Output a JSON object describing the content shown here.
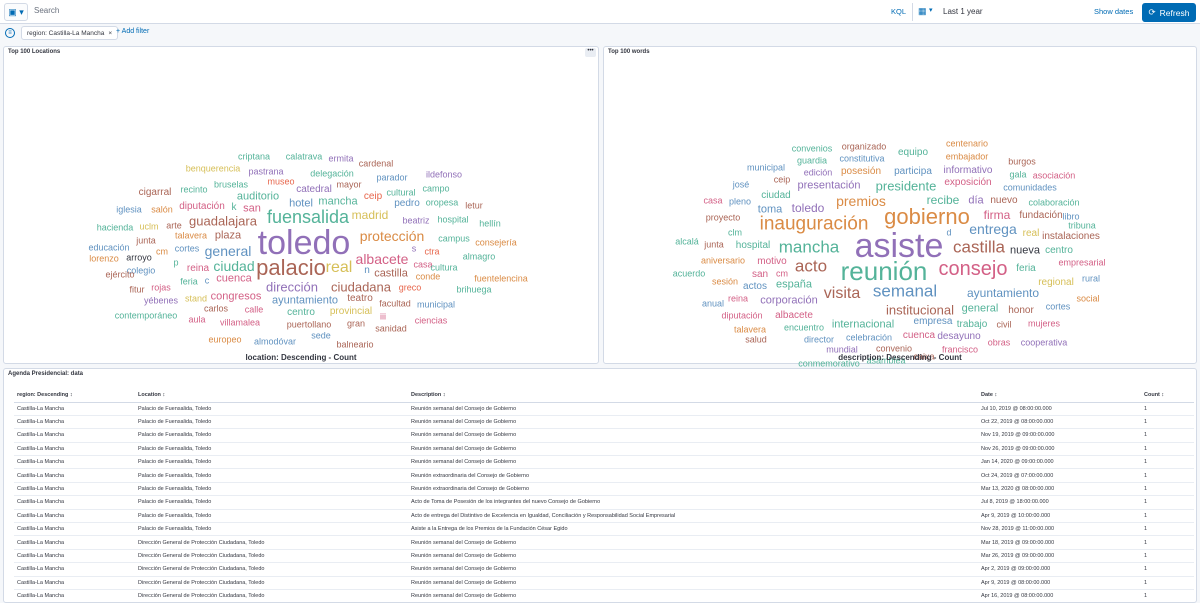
{
  "query": {
    "placeholder": "Search",
    "language": "KQL"
  },
  "time": {
    "range": "Last 1 year",
    "show_dates": "Show dates",
    "refresh": "Refresh"
  },
  "filters": {
    "pill": "region: Castilla-La Mancha",
    "remove": "×",
    "add": "+ Add filter"
  },
  "locations_panel": {
    "title": "Top 100 Locations",
    "menu": "•••",
    "caption": "location: Descending - Count"
  },
  "words_panel": {
    "title": "Top 100 words",
    "caption": "description: Descending - Count"
  },
  "locations_words": [
    [
      "criptana",
      250,
      110,
      9,
      "#54b399"
    ],
    [
      "calatrava",
      300,
      110,
      9,
      "#54b399"
    ],
    [
      "ermita",
      337,
      112,
      9,
      "#9170b8"
    ],
    [
      "cardenal",
      372,
      117,
      9,
      "#aa6556"
    ],
    [
      "benquerencia",
      209,
      122,
      9,
      "#d6bf57"
    ],
    [
      "pastrana",
      262,
      125,
      9,
      "#9170b8"
    ],
    [
      "delegación",
      328,
      127,
      9,
      "#54b399"
    ],
    [
      "ildefonso",
      440,
      128,
      9,
      "#9170b8"
    ],
    [
      "parador",
      388,
      131,
      9,
      "#6092c0"
    ],
    [
      "museo",
      277,
      135,
      9,
      "#e7664c"
    ],
    [
      "bruselas",
      227,
      138,
      9,
      "#54b399"
    ],
    [
      "mayor",
      345,
      138,
      9,
      "#aa6556"
    ],
    [
      "recinto",
      190,
      143,
      9,
      "#54b399"
    ],
    [
      "catedral",
      310,
      143,
      10,
      "#9170b8"
    ],
    [
      "campo",
      432,
      142,
      9,
      "#54b399"
    ],
    [
      "cigarral",
      151,
      146,
      10,
      "#aa6556"
    ],
    [
      "auditorio",
      254,
      150,
      11,
      "#54b399"
    ],
    [
      "cultural",
      397,
      146,
      9,
      "#54b399"
    ],
    [
      "ceip",
      369,
      150,
      10,
      "#e7664c"
    ],
    [
      "mancha",
      334,
      155,
      11,
      "#54b399"
    ],
    [
      "pedro",
      403,
      157,
      10,
      "#6092c0"
    ],
    [
      "oropesa",
      438,
      156,
      9,
      "#54b399"
    ],
    [
      "letur",
      470,
      159,
      9,
      "#aa6556"
    ],
    [
      "iglesia",
      125,
      163,
      9,
      "#6092c0"
    ],
    [
      "salón",
      158,
      163,
      9,
      "#da8b45"
    ],
    [
      "diputación",
      198,
      160,
      10,
      "#d36086"
    ],
    [
      "k",
      230,
      161,
      10,
      "#54b399"
    ],
    [
      "san",
      248,
      162,
      11,
      "#d36086"
    ],
    [
      "hotel",
      297,
      157,
      11,
      "#6092c0"
    ],
    [
      "madrid",
      366,
      168,
      12,
      "#d6bf57"
    ],
    [
      "fuensalida",
      304,
      170,
      18,
      "#54b399"
    ],
    [
      "guadalajara",
      219,
      174,
      13,
      "#aa6556"
    ],
    [
      "beatriz",
      412,
      174,
      9,
      "#9170b8"
    ],
    [
      "hospital",
      449,
      173,
      9,
      "#54b399"
    ],
    [
      "hellín",
      486,
      177,
      9,
      "#54b399"
    ],
    [
      "hacienda",
      111,
      181,
      9,
      "#54b399"
    ],
    [
      "uclm",
      145,
      180,
      9,
      "#d6bf57"
    ],
    [
      "arte",
      170,
      179,
      9,
      "#aa6556"
    ],
    [
      "junta",
      142,
      194,
      9,
      "#aa6556"
    ],
    [
      "talavera",
      187,
      189,
      9,
      "#da8b45"
    ],
    [
      "plaza",
      224,
      189,
      11,
      "#aa6556"
    ],
    [
      "toledo",
      300,
      196,
      34,
      "#9170b8"
    ],
    [
      "protección",
      388,
      189,
      14,
      "#da8b45"
    ],
    [
      "campus",
      450,
      192,
      9,
      "#54b399"
    ],
    [
      "consejería",
      492,
      196,
      9,
      "#da8b45"
    ],
    [
      "educación",
      105,
      201,
      9,
      "#6092c0"
    ],
    [
      "cm",
      158,
      205,
      9,
      "#da8b45"
    ],
    [
      "cortes",
      183,
      202,
      9,
      "#6092c0"
    ],
    [
      "general",
      224,
      204,
      14,
      "#6092c0"
    ],
    [
      "s",
      410,
      202,
      9,
      "#9170b8"
    ],
    [
      "ctra",
      428,
      205,
      9,
      "#e7664c"
    ],
    [
      "lorenzo",
      100,
      212,
      9,
      "#da8b45"
    ],
    [
      "arroyo",
      135,
      211,
      9,
      "#343741"
    ],
    [
      "p",
      172,
      216,
      9,
      "#54b399"
    ],
    [
      "almagro",
      475,
      210,
      9,
      "#54b399"
    ],
    [
      "albacete",
      378,
      212,
      14,
      "#d36086"
    ],
    [
      "palacio",
      287,
      221,
      22,
      "#aa6556"
    ],
    [
      "real",
      335,
      221,
      16,
      "#d6bf57"
    ],
    [
      "ciudad",
      230,
      219,
      14,
      "#54b399"
    ],
    [
      "reina",
      194,
      222,
      10,
      "#d36086"
    ],
    [
      "casa",
      419,
      218,
      9,
      "#d36086"
    ],
    [
      "colegio",
      137,
      224,
      9,
      "#6092c0"
    ],
    [
      "n",
      363,
      224,
      10,
      "#6092c0"
    ],
    [
      "castilla",
      387,
      227,
      11,
      "#aa6556"
    ],
    [
      "cultura",
      440,
      221,
      9,
      "#54b399"
    ],
    [
      "ejército",
      116,
      228,
      9,
      "#aa6556"
    ],
    [
      "conde",
      424,
      230,
      9,
      "#da8b45"
    ],
    [
      "feria",
      185,
      235,
      9,
      "#54b399"
    ],
    [
      "c",
      203,
      234,
      9,
      "#6092c0"
    ],
    [
      "cuenca",
      230,
      232,
      11,
      "#d36086"
    ],
    [
      "fuentelencina",
      497,
      232,
      9,
      "#da8b45"
    ],
    [
      "dirección",
      288,
      240,
      13,
      "#9170b8"
    ],
    [
      "ciudadana",
      357,
      240,
      13,
      "#aa6556"
    ],
    [
      "rojas",
      157,
      241,
      9,
      "#d36086"
    ],
    [
      "fitur",
      133,
      243,
      9,
      "#aa6556"
    ],
    [
      "greco",
      406,
      241,
      9,
      "#e7664c"
    ],
    [
      "brihuega",
      470,
      243,
      9,
      "#54b399"
    ],
    [
      "congresos",
      232,
      250,
      11,
      "#d36086"
    ],
    [
      "stand",
      192,
      252,
      9,
      "#d6bf57"
    ],
    [
      "ayuntamiento",
      301,
      254,
      11,
      "#6092c0"
    ],
    [
      "teatro",
      356,
      252,
      10,
      "#aa6556"
    ],
    [
      "yébenes",
      157,
      254,
      9,
      "#9170b8"
    ],
    [
      "facultad",
      391,
      257,
      9,
      "#aa6556"
    ],
    [
      "municipal",
      432,
      258,
      9,
      "#6092c0"
    ],
    [
      "carlos",
      212,
      262,
      9,
      "#aa6556"
    ],
    [
      "calle",
      250,
      263,
      9,
      "#d36086"
    ],
    [
      "centro",
      297,
      266,
      10,
      "#54b399"
    ],
    [
      "provincial",
      347,
      265,
      10,
      "#d6bf57"
    ],
    [
      "contemporáneo",
      142,
      269,
      9,
      "#54b399"
    ],
    [
      "iii",
      379,
      270,
      9,
      "#d36086"
    ],
    [
      "aula",
      193,
      273,
      9,
      "#d36086"
    ],
    [
      "villamalea",
      236,
      276,
      9,
      "#d36086"
    ],
    [
      "gran",
      352,
      277,
      9,
      "#aa6556"
    ],
    [
      "ciencias",
      427,
      274,
      9,
      "#d36086"
    ],
    [
      "puertollano",
      305,
      278,
      9,
      "#aa6556"
    ],
    [
      "sanidad",
      387,
      282,
      9,
      "#aa6556"
    ],
    [
      "sede",
      317,
      289,
      9,
      "#6092c0"
    ],
    [
      "europeo",
      221,
      293,
      9,
      "#da8b45"
    ],
    [
      "almodóvar",
      271,
      295,
      9,
      "#6092c0"
    ],
    [
      "balneario",
      351,
      298,
      9,
      "#aa6556"
    ]
  ],
  "description_words": [
    [
      "centenario",
      363,
      97,
      9,
      "#da8b45"
    ],
    [
      "convenios",
      208,
      102,
      9,
      "#54b399"
    ],
    [
      "organizado",
      260,
      100,
      9,
      "#aa6556"
    ],
    [
      "equipo",
      309,
      106,
      10,
      "#54b399"
    ],
    [
      "embajador",
      363,
      110,
      9,
      "#da8b45"
    ],
    [
      "guardia",
      208,
      114,
      9,
      "#54b399"
    ],
    [
      "constitutiva",
      258,
      112,
      9,
      "#6092c0"
    ],
    [
      "burgos",
      418,
      115,
      9,
      "#aa6556"
    ],
    [
      "municipal",
      162,
      121,
      9,
      "#6092c0"
    ],
    [
      "edición",
      214,
      126,
      9,
      "#9170b8"
    ],
    [
      "posesión",
      257,
      125,
      10,
      "#da8b45"
    ],
    [
      "participa",
      309,
      125,
      10,
      "#6092c0"
    ],
    [
      "informativo",
      364,
      124,
      10,
      "#9170b8"
    ],
    [
      "gala",
      414,
      128,
      9,
      "#54b399"
    ],
    [
      "asociación",
      450,
      129,
      9,
      "#d36086"
    ],
    [
      "ceip",
      178,
      133,
      9,
      "#aa6556"
    ],
    [
      "presentación",
      225,
      139,
      11,
      "#9170b8"
    ],
    [
      "presidente",
      302,
      139,
      13,
      "#54b399"
    ],
    [
      "exposición",
      364,
      136,
      10,
      "#d36086"
    ],
    [
      "comunidades",
      426,
      141,
      9,
      "#6092c0"
    ],
    [
      "josé",
      137,
      138,
      9,
      "#6092c0"
    ],
    [
      "ciudad",
      172,
      149,
      10,
      "#54b399"
    ],
    [
      "premios",
      257,
      154,
      14,
      "#da8b45"
    ],
    [
      "recibe",
      339,
      153,
      12,
      "#54b399"
    ],
    [
      "día",
      372,
      154,
      11,
      "#9170b8"
    ],
    [
      "nuevo",
      400,
      154,
      10,
      "#aa6556"
    ],
    [
      "colaboración",
      450,
      156,
      9,
      "#54b399"
    ],
    [
      "casa",
      109,
      154,
      9,
      "#d36086"
    ],
    [
      "pleno",
      136,
      155,
      9,
      "#6092c0"
    ],
    [
      "toma",
      166,
      163,
      11,
      "#6092c0"
    ],
    [
      "toledo",
      204,
      161,
      12,
      "#9170b8"
    ],
    [
      "gobierno",
      323,
      170,
      22,
      "#da8b45"
    ],
    [
      "firma",
      393,
      168,
      12,
      "#d36086"
    ],
    [
      "fundación",
      437,
      169,
      10,
      "#aa6556"
    ],
    [
      "libro",
      467,
      170,
      9,
      "#6092c0"
    ],
    [
      "proyecto",
      119,
      171,
      9,
      "#aa6556"
    ],
    [
      "inauguración",
      210,
      177,
      19,
      "#da8b45"
    ],
    [
      "entrega",
      389,
      182,
      14,
      "#6092c0"
    ],
    [
      "tribuna",
      478,
      179,
      9,
      "#54b399"
    ],
    [
      "clm",
      131,
      186,
      9,
      "#54b399"
    ],
    [
      "d",
      345,
      186,
      9,
      "#6092c0"
    ],
    [
      "asiste",
      295,
      199,
      34,
      "#9170b8"
    ],
    [
      "real",
      427,
      187,
      10,
      "#d6bf57"
    ],
    [
      "instalaciones",
      467,
      190,
      10,
      "#aa6556"
    ],
    [
      "alcalá",
      83,
      195,
      9,
      "#54b399"
    ],
    [
      "junta",
      110,
      198,
      9,
      "#aa6556"
    ],
    [
      "hospital",
      149,
      199,
      10,
      "#54b399"
    ],
    [
      "mancha",
      205,
      200,
      17,
      "#54b399"
    ],
    [
      "castilla",
      375,
      200,
      17,
      "#aa6556"
    ],
    [
      "nueva",
      421,
      204,
      11,
      "#343741"
    ],
    [
      "centro",
      455,
      204,
      10,
      "#54b399"
    ],
    [
      "aniversario",
      119,
      214,
      9,
      "#da8b45"
    ],
    [
      "motivo",
      168,
      215,
      10,
      "#d36086"
    ],
    [
      "acto",
      207,
      219,
      17,
      "#aa6556"
    ],
    [
      "reunión",
      280,
      224,
      26,
      "#54b399"
    ],
    [
      "consejo",
      369,
      222,
      20,
      "#d36086"
    ],
    [
      "feria",
      422,
      222,
      10,
      "#54b399"
    ],
    [
      "empresarial",
      478,
      216,
      9,
      "#d36086"
    ],
    [
      "acuerdo",
      85,
      227,
      9,
      "#54b399"
    ],
    [
      "san",
      156,
      228,
      10,
      "#d36086"
    ],
    [
      "cm",
      178,
      227,
      9,
      "#d36086"
    ],
    [
      "sesión",
      121,
      235,
      9,
      "#da8b45"
    ],
    [
      "actos",
      151,
      240,
      10,
      "#6092c0"
    ],
    [
      "españa",
      190,
      238,
      11,
      "#54b399"
    ],
    [
      "visita",
      238,
      247,
      16,
      "#aa6556"
    ],
    [
      "semanal",
      301,
      244,
      17,
      "#6092c0"
    ],
    [
      "ayuntamiento",
      399,
      246,
      12,
      "#6092c0"
    ],
    [
      "regional",
      452,
      236,
      10,
      "#d6bf57"
    ],
    [
      "rural",
      487,
      232,
      9,
      "#6092c0"
    ],
    [
      "reina",
      134,
      252,
      9,
      "#d36086"
    ],
    [
      "corporación",
      185,
      254,
      11,
      "#9170b8"
    ],
    [
      "social",
      484,
      252,
      9,
      "#da8b45"
    ],
    [
      "anual",
      109,
      257,
      9,
      "#6092c0"
    ],
    [
      "institucional",
      316,
      263,
      13,
      "#aa6556"
    ],
    [
      "general",
      376,
      262,
      11,
      "#54b399"
    ],
    [
      "honor",
      417,
      264,
      10,
      "#aa6556"
    ],
    [
      "cortes",
      454,
      260,
      9,
      "#6092c0"
    ],
    [
      "diputación",
      138,
      269,
      9,
      "#d36086"
    ],
    [
      "albacete",
      190,
      269,
      10,
      "#d36086"
    ],
    [
      "internacional",
      259,
      278,
      11,
      "#54b399"
    ],
    [
      "empresa",
      329,
      275,
      10,
      "#6092c0"
    ],
    [
      "trabajo",
      368,
      278,
      10,
      "#54b399"
    ],
    [
      "civil",
      400,
      278,
      9,
      "#aa6556"
    ],
    [
      "mujeres",
      440,
      277,
      9,
      "#d36086"
    ],
    [
      "talavera",
      146,
      283,
      9,
      "#da8b45"
    ],
    [
      "encuentro",
      200,
      281,
      9,
      "#54b399"
    ],
    [
      "salud",
      152,
      293,
      9,
      "#aa6556"
    ],
    [
      "director",
      215,
      293,
      9,
      "#6092c0"
    ],
    [
      "celebración",
      265,
      291,
      9,
      "#6092c0"
    ],
    [
      "cuenca",
      315,
      289,
      10,
      "#d36086"
    ],
    [
      "desayuno",
      355,
      290,
      10,
      "#9170b8"
    ],
    [
      "obras",
      395,
      296,
      9,
      "#d36086"
    ],
    [
      "cooperativa",
      440,
      296,
      9,
      "#9170b8"
    ],
    [
      "mundial",
      238,
      303,
      9,
      "#9170b8"
    ],
    [
      "convenio",
      290,
      302,
      9,
      "#aa6556"
    ],
    [
      "francisco",
      356,
      303,
      9,
      "#d36086"
    ],
    [
      "caixa",
      320,
      310,
      9,
      "#aa6556"
    ],
    [
      "conmemorativo",
      225,
      317,
      9,
      "#54b399"
    ],
    [
      "asamblea",
      282,
      314,
      9,
      "#54b399"
    ]
  ],
  "table": {
    "title": "Agenda Presidencial: data",
    "headers": [
      "region: Descending ↕",
      "Location ↕",
      "Description ↕",
      "Date ↕",
      "Count ↕"
    ],
    "rows": [
      [
        "Castilla-La Mancha",
        "Palacio de Fuensalida, Toledo",
        "Reunión semanal del Consejo de Gobierno",
        "Jul 10, 2019 @ 08:00:00.000",
        "1"
      ],
      [
        "Castilla-La Mancha",
        "Palacio de Fuensalida, Toledo",
        "Reunión semanal del Consejo de Gobierno",
        "Oct 22, 2019 @ 08:00:00.000",
        "1"
      ],
      [
        "Castilla-La Mancha",
        "Palacio de Fuensalida, Toledo",
        "Reunión semanal del Consejo de Gobierno",
        "Nov 19, 2019 @ 09:00:00.000",
        "1"
      ],
      [
        "Castilla-La Mancha",
        "Palacio de Fuensalida, Toledo",
        "Reunión semanal del Consejo de Gobierno",
        "Nov 26, 2019 @ 09:00:00.000",
        "1"
      ],
      [
        "Castilla-La Mancha",
        "Palacio de Fuensalida, Toledo",
        "Reunión semanal del Consejo de Gobierno",
        "Jan 14, 2020 @ 09:00:00.000",
        "1"
      ],
      [
        "Castilla-La Mancha",
        "Palacio de Fuensalida, Toledo",
        "Reunión extraordinaria del Consejo de Gobierno",
        "Oct 24, 2019 @ 07:00:00.000",
        "1"
      ],
      [
        "Castilla-La Mancha",
        "Palacio de Fuensalida, Toledo",
        "Reunión extraordinaria del Consejo de Gobierno",
        "Mar 13, 2020 @ 08:00:00.000",
        "1"
      ],
      [
        "Castilla-La Mancha",
        "Palacio de Fuensalida, Toledo",
        "Acto de Toma de Posesión de los integrantes del nuevo Consejo de Gobierno",
        "Jul 8, 2019 @ 18:00:00.000",
        "1"
      ],
      [
        "Castilla-La Mancha",
        "Palacio de Fuensalida, Toledo",
        "Acto de entrega del Distintivo de Excelencia en Igualdad, Conciliación y Responsabilidad Social Empresarial",
        "Apr 9, 2019 @ 10:00:00.000",
        "1"
      ],
      [
        "Castilla-La Mancha",
        "Palacio de Fuensalida, Toledo",
        "Asiste a la Entrega de los Premios de la Fundación César Egido",
        "Nov 28, 2019 @ 11:00:00.000",
        "1"
      ],
      [
        "Castilla-La Mancha",
        "Dirección General de Protección Ciudadana, Toledo",
        "Reunión semanal del Consejo de Gobierno",
        "Mar 18, 2019 @ 09:00:00.000",
        "1"
      ],
      [
        "Castilla-La Mancha",
        "Dirección General de Protección Ciudadana, Toledo",
        "Reunión semanal del Consejo de Gobierno",
        "Mar 26, 2019 @ 09:00:00.000",
        "1"
      ],
      [
        "Castilla-La Mancha",
        "Dirección General de Protección Ciudadana, Toledo",
        "Reunión semanal del Consejo de Gobierno",
        "Apr 2, 2019 @ 09:00:00.000",
        "1"
      ],
      [
        "Castilla-La Mancha",
        "Dirección General de Protección Ciudadana, Toledo",
        "Reunión semanal del Consejo de Gobierno",
        "Apr 9, 2019 @ 08:00:00.000",
        "1"
      ],
      [
        "Castilla-La Mancha",
        "Dirección General de Protección Ciudadana, Toledo",
        "Reunión semanal del Consejo de Gobierno",
        "Apr 16, 2019 @ 08:00:00.000",
        "1"
      ]
    ]
  }
}
